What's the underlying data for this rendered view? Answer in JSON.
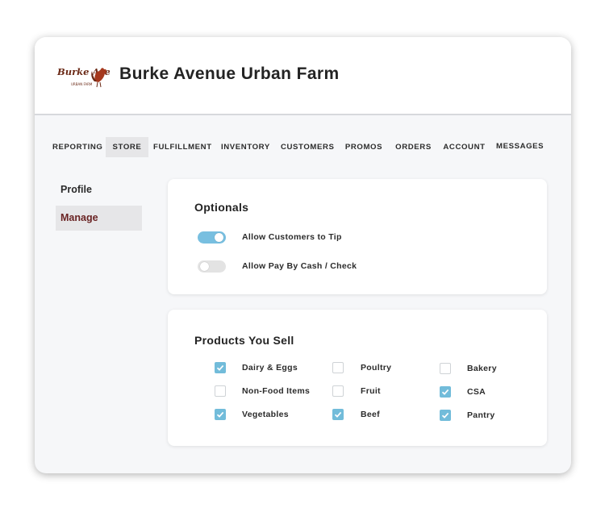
{
  "header": {
    "logo_text": "Burke Avenue",
    "logo_subtext": "URBAN FARM",
    "title": "Burke Avenue Urban Farm"
  },
  "nav": {
    "items": [
      "REPORTING",
      "STORE",
      "FULFILLMENT",
      "INVENTORY",
      "CUSTOMERS",
      "PROMOS",
      "ORDERS",
      "ACCOUNT",
      "MESSAGES"
    ],
    "active_index": 1
  },
  "sidebar": {
    "items": [
      {
        "label": "Profile",
        "active": false
      },
      {
        "label": "Manage",
        "active": true
      }
    ]
  },
  "optionals": {
    "title": "Optionals",
    "toggles": [
      {
        "label": "Allow Customers to Tip",
        "on": true
      },
      {
        "label": "Allow Pay By Cash / Check",
        "on": false
      }
    ]
  },
  "products": {
    "title": "Products You Sell",
    "items": [
      {
        "label": "Dairy & Eggs",
        "checked": true
      },
      {
        "label": "Poultry",
        "checked": false
      },
      {
        "label": "Bakery",
        "checked": false
      },
      {
        "label": "Non-Food Items",
        "checked": false
      },
      {
        "label": "Fruit",
        "checked": false
      },
      {
        "label": "CSA",
        "checked": true
      },
      {
        "label": "Vegetables",
        "checked": true
      },
      {
        "label": "Beef",
        "checked": true
      },
      {
        "label": "Pantry",
        "checked": true
      }
    ]
  },
  "colors": {
    "accent": "#72bcda",
    "active_side_text": "#6a2424",
    "logo_brown": "#6b2a17"
  }
}
